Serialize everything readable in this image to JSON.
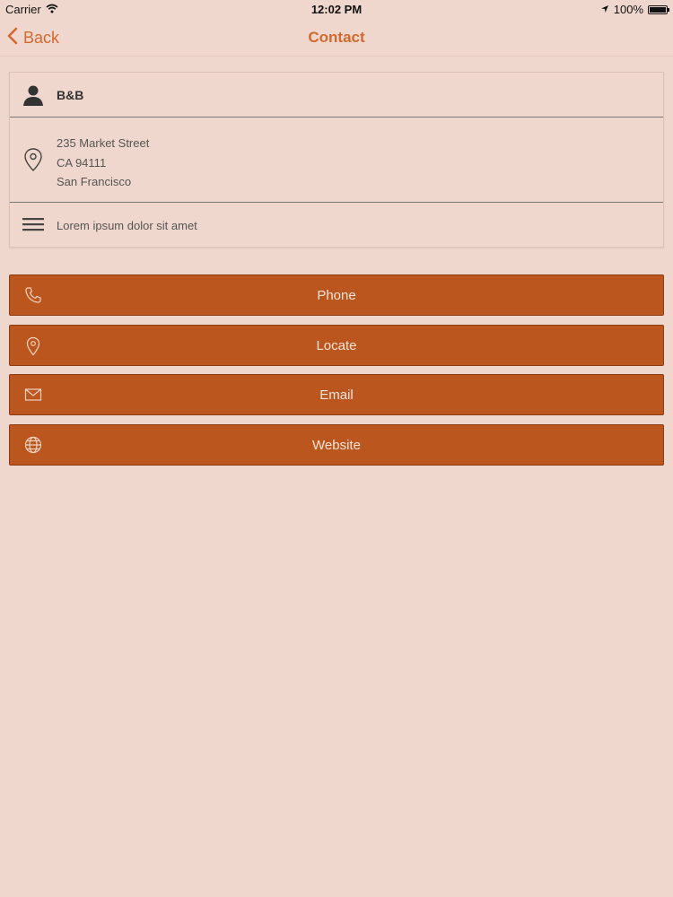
{
  "status_bar": {
    "carrier": "Carrier",
    "time": "12:02 PM",
    "battery": "100%"
  },
  "nav": {
    "back_label": "Back",
    "title": "Contact"
  },
  "contact": {
    "name": "B&B",
    "address_lines": [
      "235 Market Street",
      "CA 94111",
      "San Francisco"
    ],
    "description": "Lorem ipsum dolor sit amet"
  },
  "actions": [
    {
      "label": "Phone",
      "icon": "phone-icon"
    },
    {
      "label": "Locate",
      "icon": "location-pin-icon"
    },
    {
      "label": "Email",
      "icon": "envelope-icon"
    },
    {
      "label": "Website",
      "icon": "globe-icon"
    }
  ],
  "colors": {
    "background": "#efd7cd",
    "accent": "#d06a2f",
    "button": "#bb561e",
    "button_text": "#f6e4da"
  }
}
